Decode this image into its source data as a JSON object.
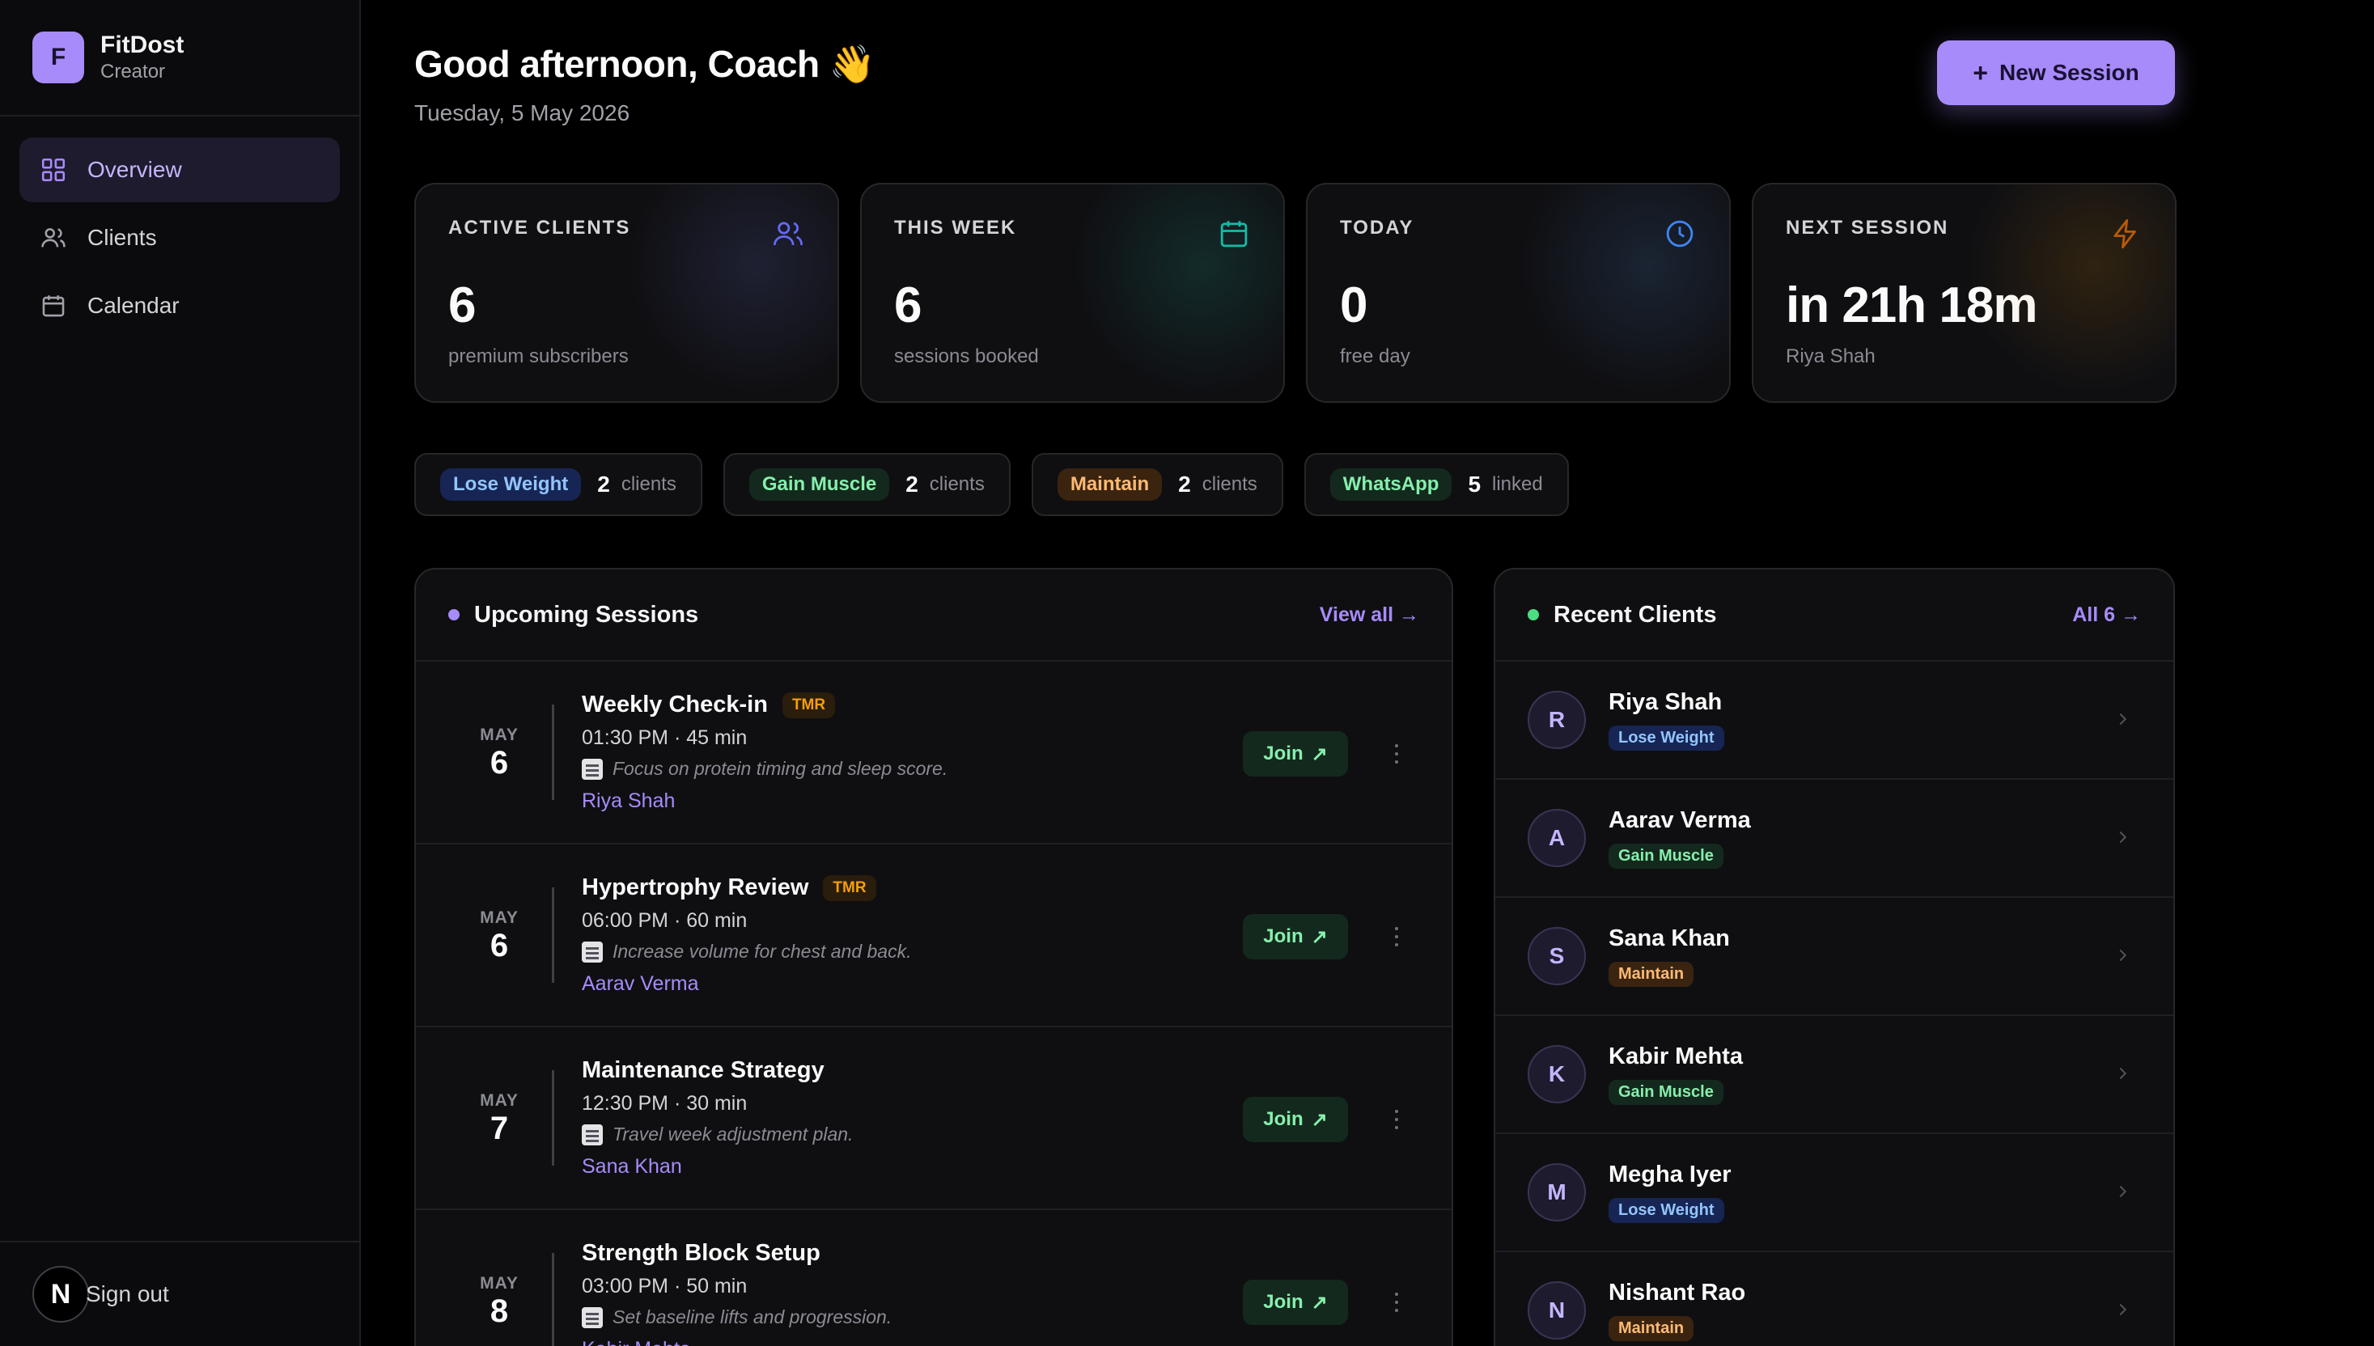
{
  "brand": {
    "initial": "F",
    "name": "FitDost",
    "role": "Creator"
  },
  "nav": [
    {
      "label": "Overview",
      "icon": "grid-icon",
      "active": true
    },
    {
      "label": "Clients",
      "icon": "users-icon",
      "active": false
    },
    {
      "label": "Calendar",
      "icon": "calendar-icon",
      "active": false
    }
  ],
  "signout": {
    "badge": "N",
    "label": "Sign out"
  },
  "header": {
    "greeting": "Good afternoon, Coach 👋",
    "date": "Tuesday, 5 May 2026",
    "new_session_label": "New Session"
  },
  "stats": [
    {
      "label": "ACTIVE CLIENTS",
      "value": "6",
      "sub": "premium subscribers",
      "icon": "users-icon"
    },
    {
      "label": "THIS WEEK",
      "value": "6",
      "sub": "sessions booked",
      "icon": "calendar-icon"
    },
    {
      "label": "TODAY",
      "value": "0",
      "sub": "free day",
      "icon": "clock-icon"
    },
    {
      "label": "NEXT SESSION",
      "value": "in 21h 18m",
      "sub": "Riya Shah",
      "icon": "lightning-icon"
    }
  ],
  "pills": [
    {
      "tag": "Lose Weight",
      "count": "2",
      "unit": "clients",
      "color": "blue"
    },
    {
      "tag": "Gain Muscle",
      "count": "2",
      "unit": "clients",
      "color": "green"
    },
    {
      "tag": "Maintain",
      "count": "2",
      "unit": "clients",
      "color": "orange"
    },
    {
      "tag": "WhatsApp",
      "count": "5",
      "unit": "linked",
      "color": "green"
    }
  ],
  "sessions_panel": {
    "title": "Upcoming Sessions",
    "link": "View all →",
    "join_label": "Join",
    "rows": [
      {
        "month": "MAY",
        "day": "6",
        "title": "Weekly Check-in",
        "badge": "TMR",
        "time": "01:30 PM · 45 min",
        "note": "Focus on protein timing and sleep score.",
        "client": "Riya Shah"
      },
      {
        "month": "MAY",
        "day": "6",
        "title": "Hypertrophy Review",
        "badge": "TMR",
        "time": "06:00 PM · 60 min",
        "note": "Increase volume for chest and back.",
        "client": "Aarav Verma"
      },
      {
        "month": "MAY",
        "day": "7",
        "title": "Maintenance Strategy",
        "badge": "",
        "time": "12:30 PM · 30 min",
        "note": "Travel week adjustment plan.",
        "client": "Sana Khan"
      },
      {
        "month": "MAY",
        "day": "8",
        "title": "Strength Block Setup",
        "badge": "",
        "time": "03:00 PM · 50 min",
        "note": "Set baseline lifts and progression.",
        "client": "Kabir Mehta"
      }
    ]
  },
  "clients_panel": {
    "title": "Recent Clients",
    "link": "All 6 →",
    "rows": [
      {
        "initial": "R",
        "name": "Riya Shah",
        "goal": "Lose Weight",
        "color": "blue"
      },
      {
        "initial": "A",
        "name": "Aarav Verma",
        "goal": "Gain Muscle",
        "color": "green"
      },
      {
        "initial": "S",
        "name": "Sana Khan",
        "goal": "Maintain",
        "color": "orange"
      },
      {
        "initial": "K",
        "name": "Kabir Mehta",
        "goal": "Gain Muscle",
        "color": "green"
      },
      {
        "initial": "M",
        "name": "Megha Iyer",
        "goal": "Lose Weight",
        "color": "blue"
      },
      {
        "initial": "N",
        "name": "Nishant Rao",
        "goal": "Maintain",
        "color": "orange"
      }
    ]
  },
  "colors": {
    "accent": "#a78bfa",
    "success": "#86efac",
    "warning": "#f59e0b",
    "info": "#93c5fd",
    "background": "#000000"
  }
}
